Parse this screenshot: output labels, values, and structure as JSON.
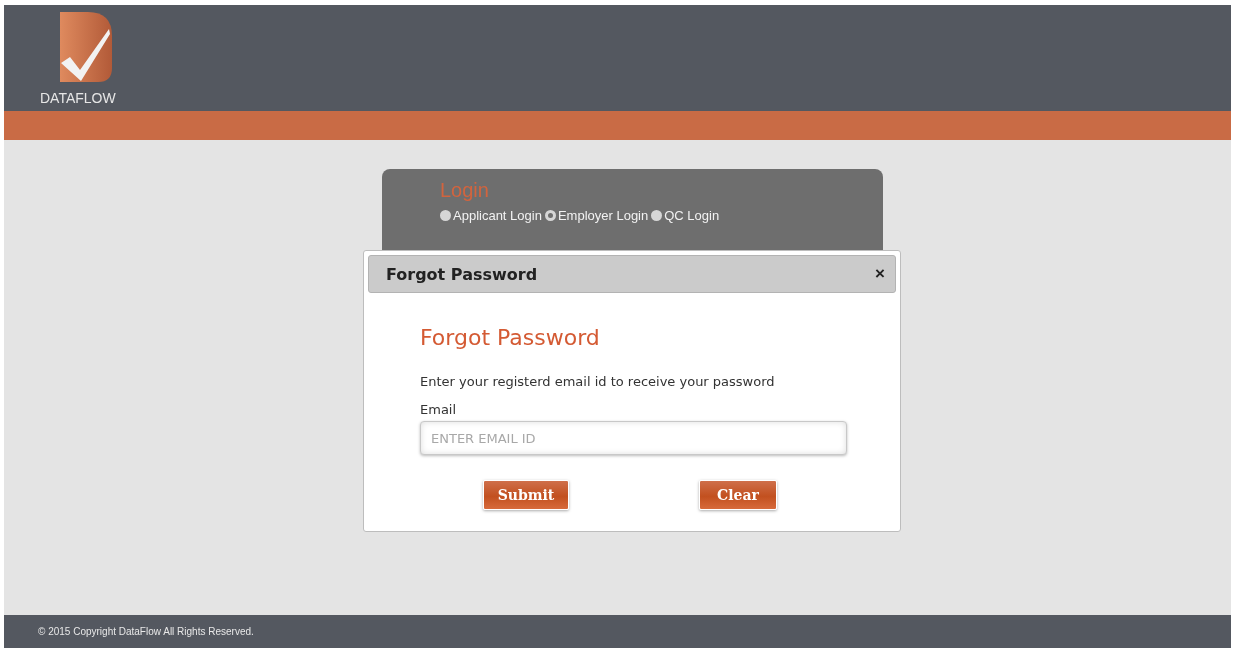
{
  "header": {
    "logo_text": "DATAFLOW"
  },
  "login_card": {
    "title": "Login",
    "options": [
      {
        "label": "Applicant Login",
        "selected": false
      },
      {
        "label": "Employer Login",
        "selected": true
      },
      {
        "label": "QC Login",
        "selected": false
      }
    ]
  },
  "dialog": {
    "title": "Forgot Password",
    "close": "×",
    "heading": "Forgot Password",
    "instruction": "Enter your registerd email id to receive your password",
    "email_label": "Email",
    "email_placeholder": "ENTER EMAIL ID",
    "buttons": [
      "Submit",
      "Clear"
    ]
  },
  "footer": {
    "text": "© 2015 Copyright DataFlow All Rights Reserved."
  }
}
